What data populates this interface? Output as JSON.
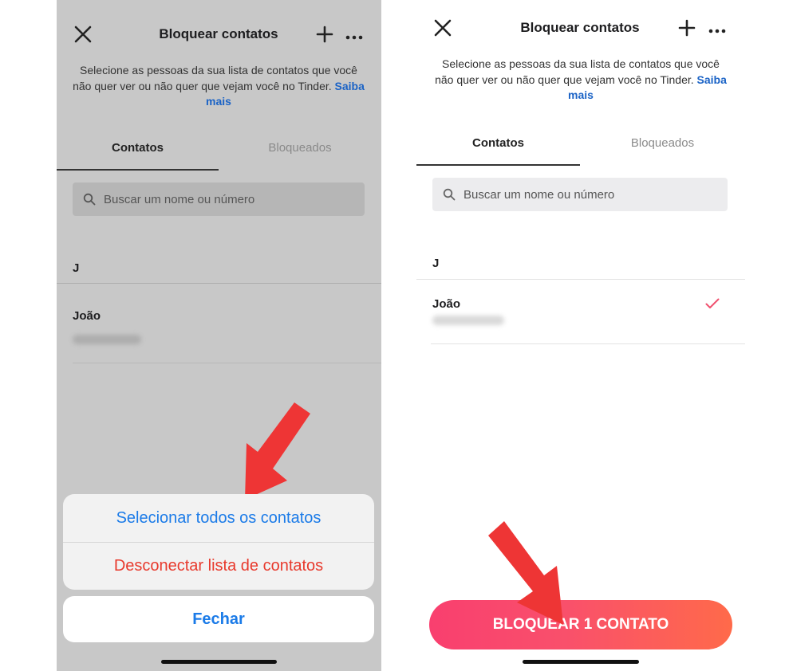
{
  "header": {
    "title": "Bloquear contatos"
  },
  "description": {
    "text": "Selecione as pessoas da sua lista de contatos que você não quer ver ou não quer que vejam você no Tinder.",
    "link": "Saiba mais"
  },
  "tabs": {
    "contacts": "Contatos",
    "blocked": "Bloqueados"
  },
  "search": {
    "placeholder": "Buscar um nome ou número"
  },
  "list": {
    "section_letter": "J",
    "contact_name": "João"
  },
  "action_sheet": {
    "select_all": "Selecionar todos os contatos",
    "disconnect": "Desconectar lista de contatos",
    "close": "Fechar"
  },
  "cta": {
    "label": "BLOQUEAR 1 CONTATO"
  },
  "colors": {
    "accent_blue": "#1b7be8",
    "destructive_red": "#e8392c",
    "link_blue": "#1b63c6",
    "check_red": "#f0506e",
    "arrow_red": "#ee3535",
    "cta_gradient_start": "#f93f6f",
    "cta_gradient_end": "#ff6a4a"
  },
  "icons": {
    "close": "close-icon",
    "add": "plus-icon",
    "more": "more-icon",
    "search": "search-icon",
    "check": "checkmark-icon",
    "arrow": "red-arrow-icon"
  }
}
